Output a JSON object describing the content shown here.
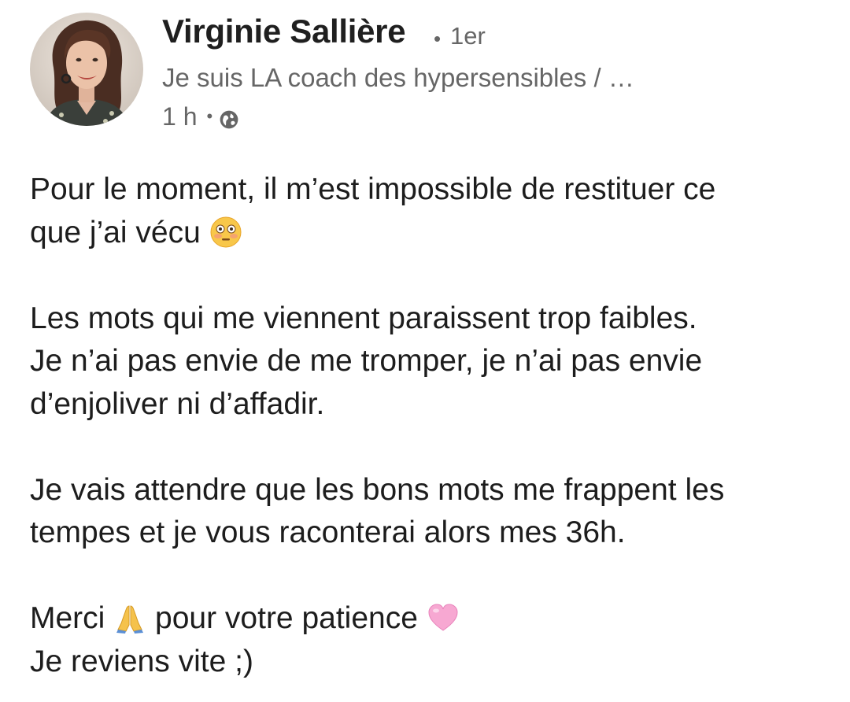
{
  "post": {
    "author": {
      "name": "Virginie Sallière",
      "connection_degree": "1er",
      "headline": "Je suis LA coach des hypersensibles / …",
      "avatar_alt": "Virginie Sallière profile photo"
    },
    "meta": {
      "time_ago": "1 h",
      "visibility_icon": "globe-icon"
    },
    "body": {
      "p1": {
        "line1": "Pour le moment, il m’est impossible de restituer ce",
        "line2": "que j’ai vécu",
        "emoji": "flushed-face-emoji"
      },
      "p2": {
        "line1": "Les mots qui me viennent paraissent trop faibles.",
        "line2": "Je n’ai pas envie de me tromper, je n’ai pas envie",
        "line3": "d’enjoliver ni d’affadir."
      },
      "p3": {
        "line1": "Je vais attendre que les bons mots me frappent les",
        "line2": "tempes et je vous raconterai alors mes 36h."
      },
      "p4": {
        "line1_before": "Merci",
        "line1_emoji1": "folded-hands-emoji",
        "line1_after": "pour votre patience",
        "line1_emoji2": "pink-heart-emoji",
        "line2": "Je reviens vite ;)"
      }
    },
    "colors": {
      "text_primary": "#1d1d1d",
      "text_secondary": "#666666",
      "background": "#ffffff"
    }
  }
}
